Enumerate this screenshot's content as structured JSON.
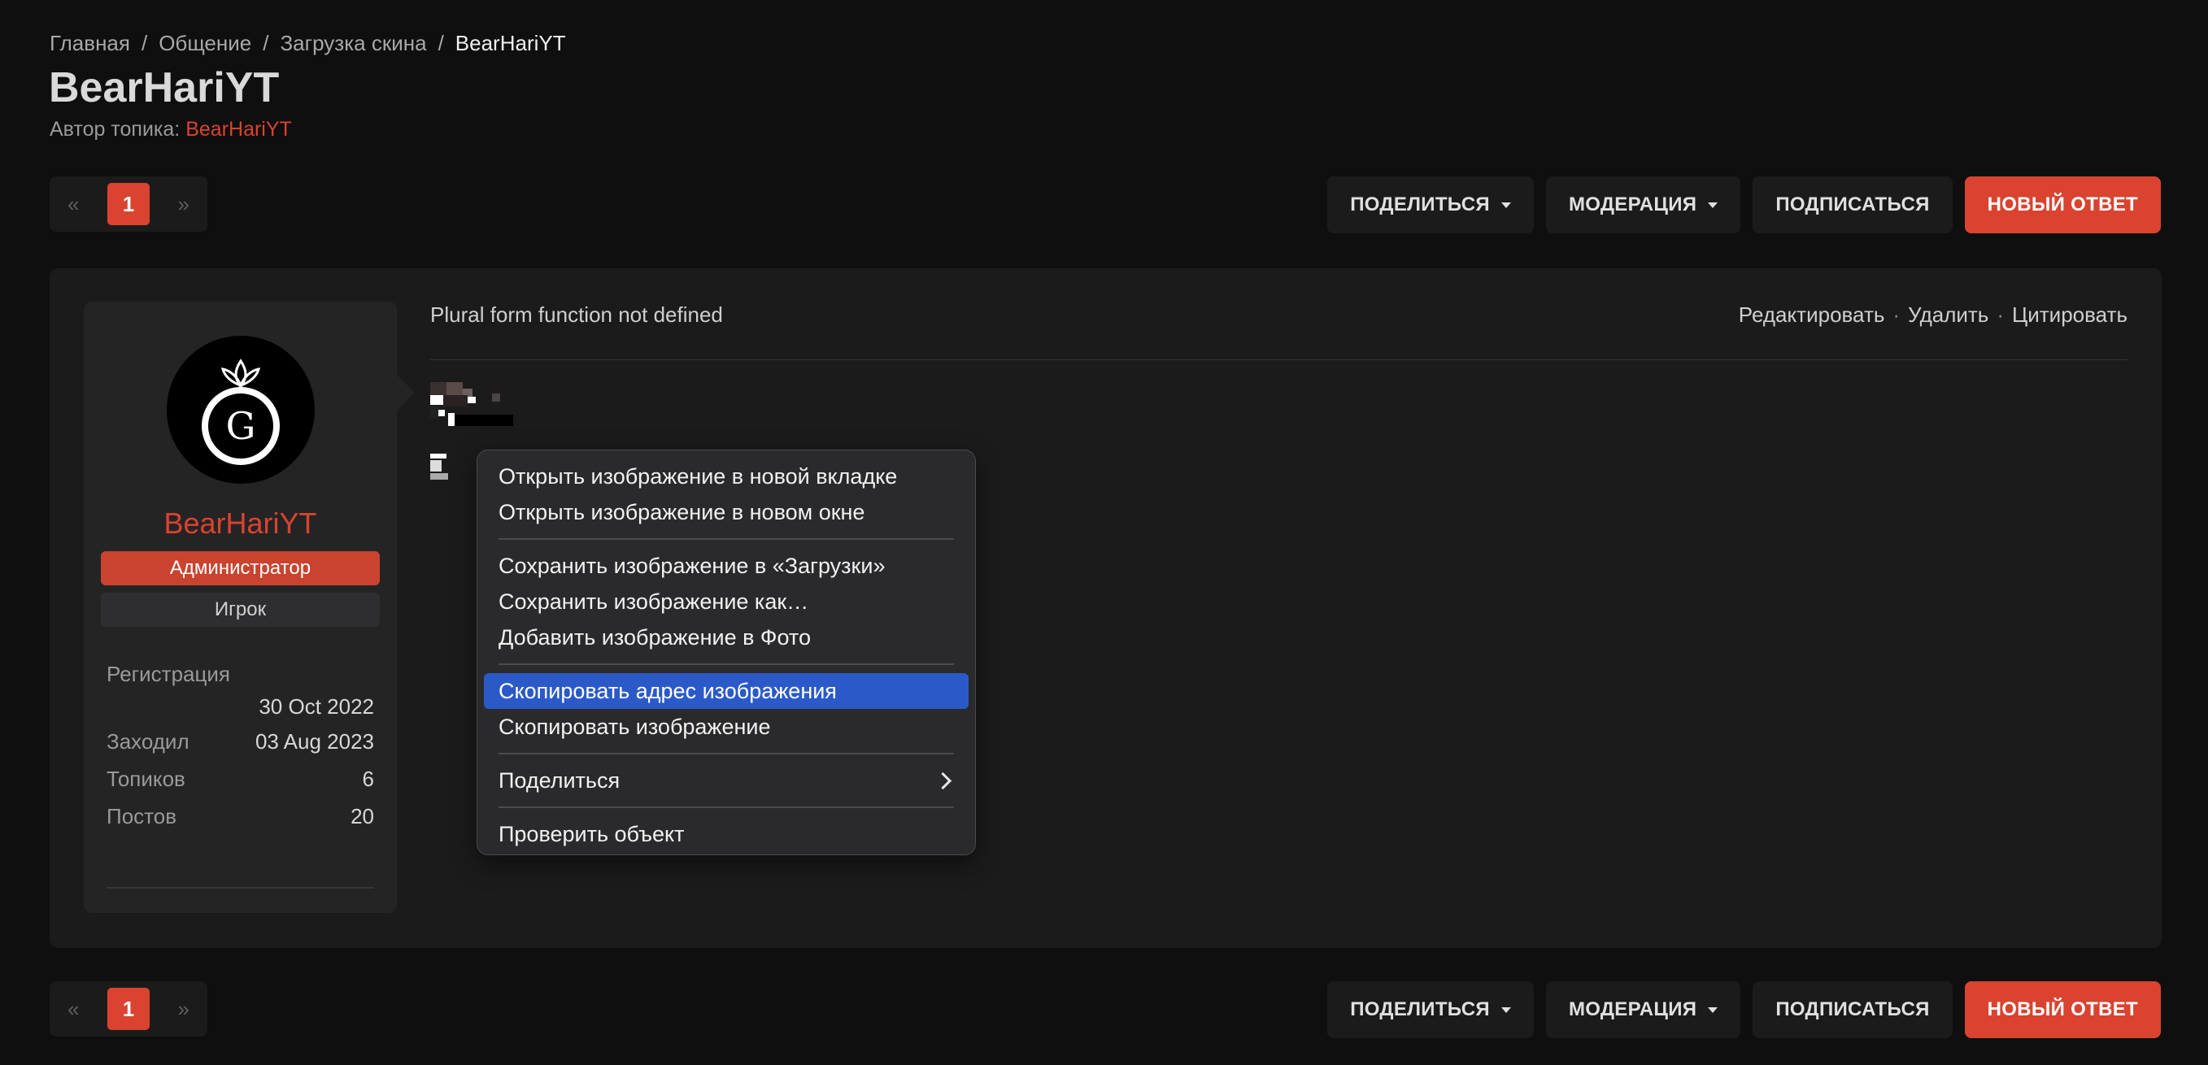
{
  "breadcrumb": [
    "Главная",
    "Общение",
    "Загрузка скина",
    "BearHariYT"
  ],
  "page": {
    "title": "BearHariYT",
    "author_label": "Автор топика:",
    "author_name": "BearHariYT"
  },
  "pagination": {
    "prev": "«",
    "current": "1",
    "next": "»"
  },
  "actions": {
    "share": "ПОДЕЛИТЬСЯ",
    "moderation": "МОДЕРАЦИЯ",
    "subscribe": "ПОДПИСАТЬСЯ",
    "new_reply": "НОВЫЙ ОТВЕТ"
  },
  "user": {
    "name": "BearHariYT",
    "avatar_letter": "G",
    "roles": [
      "Администратор",
      "Игрок"
    ],
    "stats": {
      "registration_label": "Регистрация",
      "registration_value": "30 Oct 2022",
      "last_seen_label": "Заходил",
      "last_seen_value": "03 Aug 2023",
      "topics_label": "Топиков",
      "topics_value": "6",
      "posts_label": "Постов",
      "posts_value": "20"
    }
  },
  "post": {
    "meta": "Plural form function not defined",
    "links": {
      "edit": "Редактировать",
      "delete": "Удалить",
      "quote": "Цитировать",
      "separator": "·"
    }
  },
  "context_menu": {
    "items": [
      "Открыть изображение в новой вкладке",
      "Открыть изображение в новом окне",
      "Сохранить изображение в «Загрузки»",
      "Сохранить изображение как…",
      "Добавить изображение в Фото",
      "Скопировать адрес изображения",
      "Скопировать изображение",
      "Поделиться",
      "Проверить объект"
    ]
  },
  "colors": {
    "accent": "#d9432f",
    "menu_highlight": "#2b5ac8",
    "background": "#0f0f10",
    "card": "#1b1b1c"
  }
}
